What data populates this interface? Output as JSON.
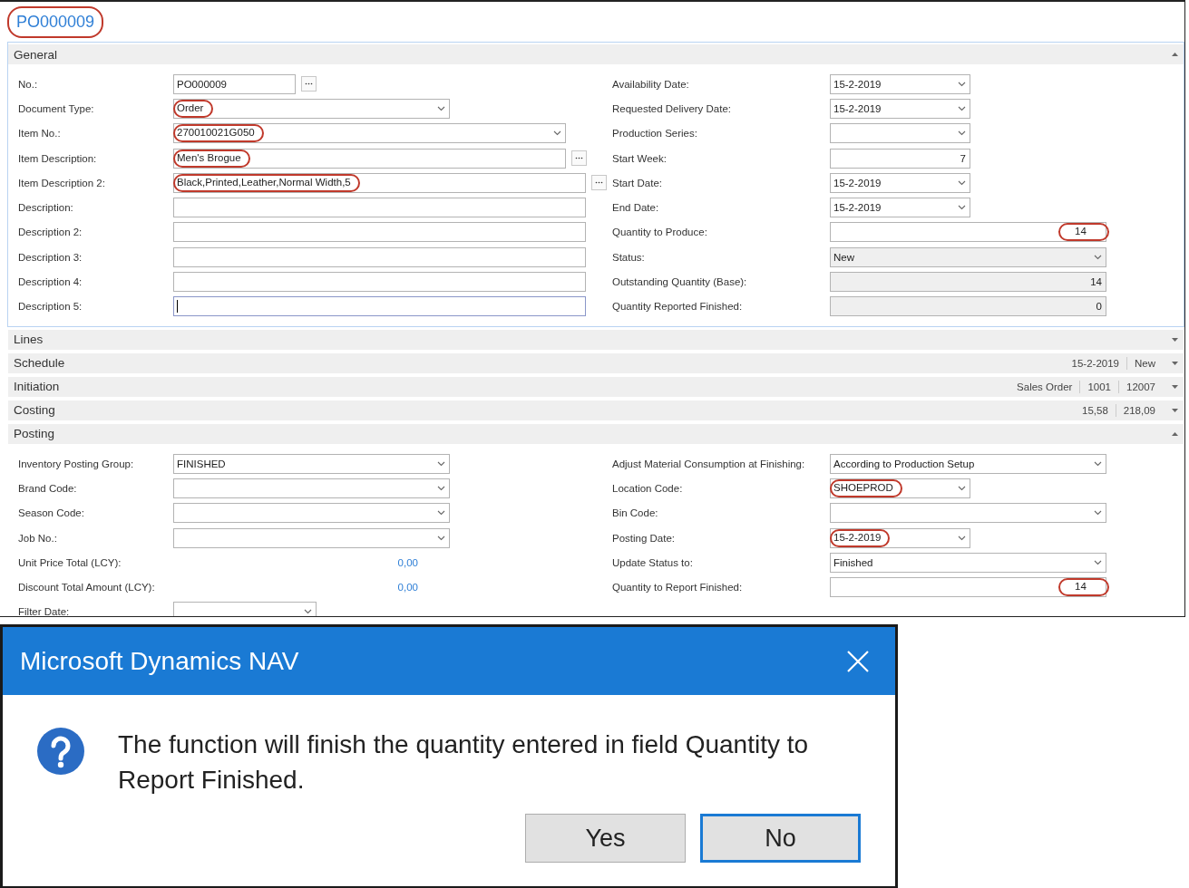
{
  "page": {
    "title": "PO000009",
    "title_annotated": true
  },
  "sections": [
    {
      "title": "General",
      "expanded": true,
      "active": true,
      "left": [
        {
          "label": "No.:",
          "value": "PO000009",
          "kind": "lookup",
          "readonly": false,
          "annotated": false,
          "focused": false
        },
        {
          "label": "Document Type:",
          "value": "Order",
          "kind": "dropdown",
          "readonly": false,
          "annotated": true,
          "focused": false
        },
        {
          "label": "Item No.:",
          "value": "270010021G050",
          "kind": "dropdown",
          "readonly": false,
          "annotated": true,
          "focused": false
        },
        {
          "label": "Item Description:",
          "value": "Men's Brogue",
          "kind": "lookup",
          "readonly": false,
          "annotated": true,
          "focused": false
        },
        {
          "label": "Item Description 2:",
          "value": "Black,Printed,Leather,Normal Width,5",
          "kind": "lookup",
          "readonly": false,
          "annotated": true,
          "focused": false
        },
        {
          "label": "Description:",
          "kind": "text",
          "readonly": false,
          "annotated": false,
          "focused": false
        },
        {
          "label": "Description 2:",
          "kind": "text",
          "readonly": false,
          "annotated": false,
          "focused": false
        },
        {
          "label": "Description 3:",
          "kind": "text",
          "readonly": false,
          "annotated": false,
          "focused": false
        },
        {
          "label": "Description 4:",
          "kind": "text",
          "readonly": false,
          "annotated": false,
          "focused": false
        },
        {
          "label": "Description 5:",
          "kind": "text",
          "readonly": false,
          "annotated": false,
          "focused": true
        }
      ],
      "right": [
        {
          "label": "Availability Date:",
          "value": "15-2-2019",
          "kind": "dropdown",
          "readonly": false,
          "annotated": false
        },
        {
          "label": "Requested Delivery Date:",
          "value": "15-2-2019",
          "kind": "dropdown",
          "readonly": false,
          "annotated": false
        },
        {
          "label": "Production Series:",
          "kind": "dropdown",
          "readonly": false,
          "annotated": false
        },
        {
          "label": "Start Week:",
          "value": "7",
          "kind": "number",
          "readonly": false,
          "annotated": false
        },
        {
          "label": "Start Date:",
          "value": "15-2-2019",
          "kind": "dropdown",
          "readonly": false,
          "annotated": false
        },
        {
          "label": "End Date:",
          "value": "15-2-2019",
          "kind": "dropdown",
          "readonly": false,
          "annotated": false
        },
        {
          "label": "Quantity to Produce:",
          "value": "14",
          "kind": "number",
          "readonly": false,
          "annotated": true
        },
        {
          "label": "Status:",
          "value": "New",
          "kind": "dropdown",
          "readonly": true,
          "annotated": false
        },
        {
          "label": "Outstanding Quantity (Base):",
          "value": "14",
          "kind": "number",
          "readonly": true,
          "annotated": false
        },
        {
          "label": "Quantity Reported Finished:",
          "value": "0",
          "kind": "number",
          "readonly": true,
          "annotated": false
        }
      ]
    },
    {
      "title": "Lines",
      "expanded": false,
      "active": false
    },
    {
      "title": "Schedule",
      "expanded": false,
      "active": false,
      "summary": [
        "15-2-2019",
        "New"
      ]
    },
    {
      "title": "Initiation",
      "expanded": false,
      "active": false,
      "summary": [
        "Sales Order",
        "1001",
        "12007"
      ]
    },
    {
      "title": "Costing",
      "expanded": false,
      "active": false,
      "summary": [
        "15,58",
        "218,09"
      ]
    },
    {
      "title": "Posting",
      "expanded": true,
      "active": false,
      "left": [
        {
          "label": "Inventory Posting Group:",
          "value": "FINISHED",
          "kind": "dropdown",
          "readonly": false,
          "annotated": false
        },
        {
          "label": "Brand Code:",
          "kind": "dropdown",
          "readonly": false,
          "annotated": false
        },
        {
          "label": "Season Code:",
          "kind": "dropdown",
          "readonly": false,
          "annotated": false
        },
        {
          "label": "Job No.:",
          "kind": "dropdown",
          "readonly": false,
          "annotated": false
        },
        {
          "label": "Unit Price Total (LCY):",
          "value": "0,00",
          "kind": "amount"
        },
        {
          "label": "Discount Total Amount (LCY):",
          "value": "0,00",
          "kind": "amount"
        },
        {
          "label": "Filter Date:",
          "kind": "dropdown",
          "readonly": false,
          "annotated": false
        }
      ],
      "right": [
        {
          "label": "Adjust Material Consumption at Finishing:",
          "value": "According to Production Setup",
          "kind": "dropdown",
          "readonly": false,
          "annotated": false
        },
        {
          "label": "Location Code:",
          "value": "SHOEPROD",
          "kind": "dropdown",
          "readonly": false,
          "annotated": true
        },
        {
          "label": "Bin Code:",
          "kind": "dropdown",
          "readonly": false,
          "annotated": false
        },
        {
          "label": "Posting Date:",
          "value": "15-2-2019",
          "kind": "dropdown",
          "readonly": false,
          "annotated": true
        },
        {
          "label": "Update Status to:",
          "value": "Finished",
          "kind": "dropdown",
          "readonly": false,
          "annotated": false
        },
        {
          "label": "Quantity to Report Finished:",
          "value": "14",
          "kind": "number",
          "readonly": false,
          "annotated": true
        }
      ]
    }
  ],
  "dialog": {
    "title": "Microsoft Dynamics NAV",
    "message": "The function will finish the quantity entered in field Quantity to Report Finished.",
    "buttons": [
      {
        "label": "Yes",
        "selected": false
      },
      {
        "label": "No",
        "selected": true
      }
    ]
  }
}
